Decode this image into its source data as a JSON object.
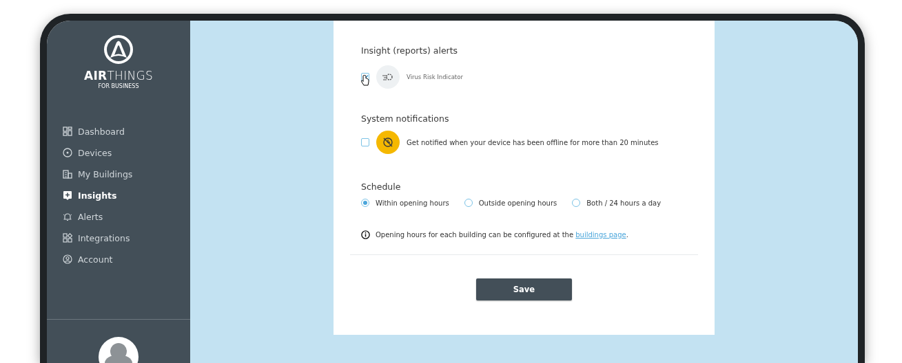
{
  "sidebar": {
    "logo": {
      "wordmark": "**AIR**THINGS",
      "tagline": "FOR BUSINESS"
    },
    "nav": [
      {
        "label": "Dashboard",
        "selected": false
      },
      {
        "label": "Devices",
        "selected": false
      },
      {
        "label": "My Buildings",
        "selected": false
      },
      {
        "label": "Insights",
        "selected": true
      },
      {
        "label": "Alerts",
        "selected": false
      },
      {
        "label": "Integrations",
        "selected": false
      },
      {
        "label": "Account",
        "selected": false
      }
    ]
  },
  "insight_alerts": {
    "title": "Insight (reports) alerts",
    "items": [
      {
        "label": "Virus Risk Indicator",
        "checked": true
      }
    ]
  },
  "system_notifications": {
    "title": "System notifications",
    "items": [
      {
        "label": "Get notified when your device has been offline for more than 20 minutes",
        "checked": false
      }
    ]
  },
  "schedule": {
    "title": "Schedule",
    "options": [
      {
        "label": "Within opening hours",
        "selected": true
      },
      {
        "label": "Outside opening hours",
        "selected": false
      },
      {
        "label": "Both / 24 hours a day",
        "selected": false
      }
    ]
  },
  "note": {
    "text": "Opening hours for each building can be configured at the ",
    "link": "buildings page",
    "end": "."
  },
  "save_button": "Save"
}
